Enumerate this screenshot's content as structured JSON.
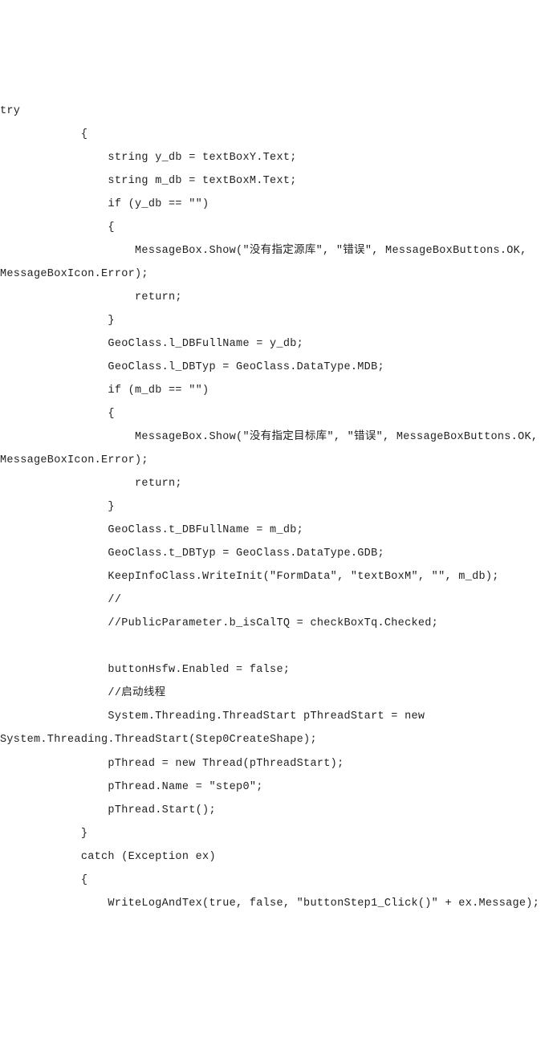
{
  "code_lines": [
    "try",
    "            {",
    "                string y_db = textBoxY.Text;",
    "                string m_db = textBoxM.Text;",
    "                if (y_db == \"\")",
    "                {",
    "                    MessageBox.Show(\"没有指定源库\", \"错误\", MessageBoxButtons.OK,",
    "MessageBoxIcon.Error);",
    "                    return;",
    "                }",
    "                GeoClass.l_DBFullName = y_db;",
    "                GeoClass.l_DBTyp = GeoClass.DataType.MDB;",
    "                if (m_db == \"\")",
    "                {",
    "                    MessageBox.Show(\"没有指定目标库\", \"错误\", MessageBoxButtons.OK,",
    "MessageBoxIcon.Error);",
    "                    return;",
    "                }",
    "                GeoClass.t_DBFullName = m_db;",
    "                GeoClass.t_DBTyp = GeoClass.DataType.GDB;",
    "                KeepInfoClass.WriteInit(\"FormData\", \"textBoxM\", \"\", m_db);",
    "                //",
    "                //PublicParameter.b_isCalTQ = checkBoxTq.Checked;",
    "",
    "                buttonHsfw.Enabled = false;",
    "                //启动线程",
    "                System.Threading.ThreadStart pThreadStart = new",
    "System.Threading.ThreadStart(Step0CreateShape);",
    "                pThread = new Thread(pThreadStart);",
    "                pThread.Name = \"step0\";",
    "                pThread.Start();",
    "            }",
    "            catch (Exception ex)",
    "            {",
    "                WriteLogAndTex(true, false, \"buttonStep1_Click()\" + ex.Message);"
  ]
}
